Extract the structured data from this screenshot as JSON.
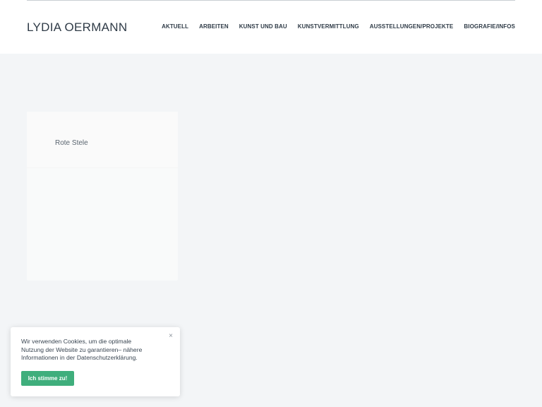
{
  "header": {
    "site_title": "LYDIA OERMANN",
    "nav": [
      {
        "label": "AKTUELL"
      },
      {
        "label": "ARBEITEN"
      },
      {
        "label": "KUNST UND BAU"
      },
      {
        "label": "KUNSTVERMITTLUNG"
      },
      {
        "label": "AUSSTELLUNGEN/PROJEKTE"
      },
      {
        "label": "BIOGRAFIE/INFOS"
      }
    ]
  },
  "main": {
    "card": {
      "title": "Rote Stele"
    }
  },
  "cookie_banner": {
    "text": "Wir verwenden Cookies, um die optimale Nutzung der Website zu garantieren– nähere Informationen in der Datenschutzerklärung.",
    "close_symbol": "×",
    "accept_label": "Ich stimme zu!",
    "accent_color": "#3fae7c"
  }
}
